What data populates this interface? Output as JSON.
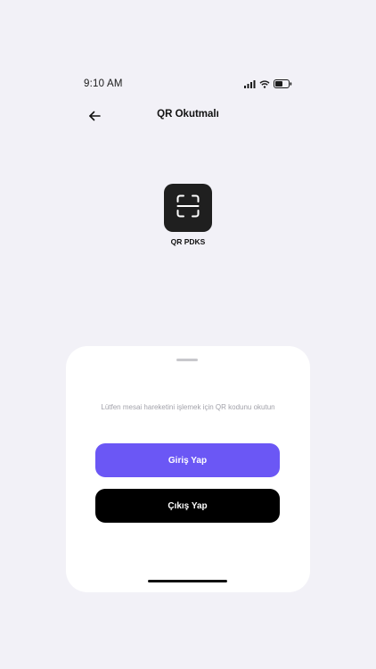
{
  "status_bar": {
    "time": "9:10 AM",
    "icons": [
      "signal-icon",
      "wifi-icon",
      "battery-icon"
    ]
  },
  "header": {
    "title": "QR Okutmalı",
    "back_icon": "arrow-left-icon"
  },
  "qr_tile": {
    "icon": "qr-scan-icon",
    "label": "QR PDKS"
  },
  "sheet": {
    "message": "Lütfen mesai hareketini işlemek için QR kodunu okutun",
    "login_label": "Giriş Yap",
    "logout_label": "Çıkış Yap"
  },
  "colors": {
    "background": "#f2f1f7",
    "primary": "#6b57f5",
    "dark": "#000000",
    "tile": "#1f1f1f"
  }
}
